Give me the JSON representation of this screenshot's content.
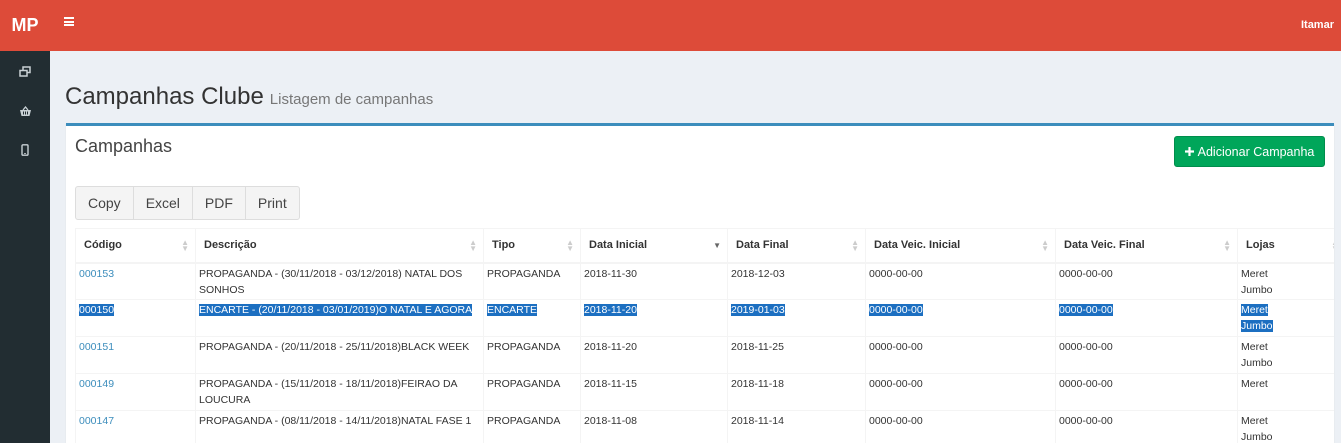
{
  "app": {
    "logo": "MP",
    "user": "Itamar"
  },
  "sidebar": {
    "icons": [
      "clone-icon",
      "basket-icon",
      "mobile-icon"
    ]
  },
  "page": {
    "title": "Campanhas Clube",
    "subtitle": "Listagem de campanhas"
  },
  "box": {
    "title": "Campanhas",
    "add_button": "Adicionar Campanha"
  },
  "toolbar": {
    "copy": "Copy",
    "excel": "Excel",
    "pdf": "PDF",
    "print": "Print"
  },
  "table": {
    "headers": [
      "Código",
      "Descrição",
      "Tipo",
      "Data Inicial",
      "Data Final",
      "Data Veic. Inicial",
      "Data Veic. Final",
      "Lojas"
    ],
    "rows": [
      {
        "codigo": "000153",
        "descricao": "PROPAGANDA - (30/11/2018 - 03/12/2018) NATAL DOS SONHOS",
        "tipo": "PROPAGANDA",
        "data_inicial": "2018-11-30",
        "data_final": "2018-12-03",
        "veic_inicial": "0000-00-00",
        "veic_final": "0000-00-00",
        "lojas": [
          "Meret",
          "Jumbo"
        ]
      },
      {
        "codigo": "000150",
        "descricao": "ENCARTE - (20/11/2018 - 03/01/2019)O NATAL E AGORA",
        "tipo": "ENCARTE",
        "data_inicial": "2018-11-20",
        "data_final": "2019-01-03",
        "veic_inicial": "0000-00-00",
        "veic_final": "0000-00-00",
        "lojas": [
          "Meret",
          "Jumbo"
        ]
      },
      {
        "codigo": "000151",
        "descricao": "PROPAGANDA - (20/11/2018 - 25/11/2018)BLACK WEEK",
        "tipo": "PROPAGANDA",
        "data_inicial": "2018-11-20",
        "data_final": "2018-11-25",
        "veic_inicial": "0000-00-00",
        "veic_final": "0000-00-00",
        "lojas": [
          "Meret",
          "Jumbo"
        ]
      },
      {
        "codigo": "000149",
        "descricao": "PROPAGANDA - (15/11/2018 - 18/11/2018)FEIRAO DA LOUCURA",
        "tipo": "PROPAGANDA",
        "data_inicial": "2018-11-15",
        "data_final": "2018-11-18",
        "veic_inicial": "0000-00-00",
        "veic_final": "0000-00-00",
        "lojas": [
          "Meret"
        ]
      },
      {
        "codigo": "000147",
        "descricao": "PROPAGANDA - (08/11/2018 - 14/11/2018)NATAL FASE 1",
        "tipo": "PROPAGANDA",
        "data_inicial": "2018-11-08",
        "data_final": "2018-11-14",
        "veic_inicial": "0000-00-00",
        "veic_final": "0000-00-00",
        "lojas": [
          "Meret",
          "Jumbo"
        ]
      }
    ]
  },
  "colors": {
    "brand": "#dd4b39",
    "sidebar": "#222d32",
    "accent": "#3c8dbc",
    "success": "#00a65a",
    "selection": "#1c6fc1"
  }
}
